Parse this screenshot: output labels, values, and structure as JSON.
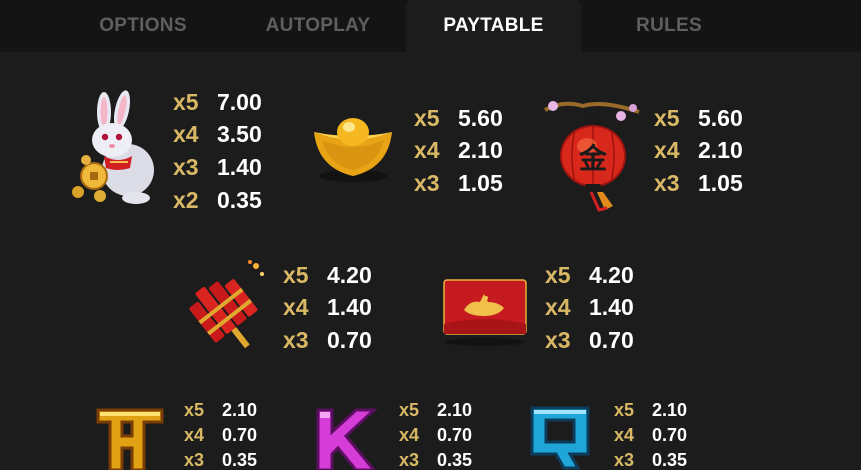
{
  "tabs": [
    {
      "label": "OPTIONS"
    },
    {
      "label": "AUTOPLAY"
    },
    {
      "label": "PAYTABLE"
    },
    {
      "label": "RULES"
    }
  ],
  "active_tab": "PAYTABLE",
  "colors": {
    "multiplier": "#d8b865",
    "value": "#ffffff",
    "background": "#1c1c1c",
    "tab_inactive": "#5f5f5f"
  },
  "symbols": [
    {
      "icon": "rabbit-icon",
      "pays": [
        {
          "m": "x5",
          "v": "7.00"
        },
        {
          "m": "x4",
          "v": "3.50"
        },
        {
          "m": "x3",
          "v": "1.40"
        },
        {
          "m": "x2",
          "v": "0.35"
        }
      ]
    },
    {
      "icon": "gold-ingot-icon",
      "pays": [
        {
          "m": "x5",
          "v": "5.60"
        },
        {
          "m": "x4",
          "v": "2.10"
        },
        {
          "m": "x3",
          "v": "1.05"
        }
      ]
    },
    {
      "icon": "lantern-icon",
      "pays": [
        {
          "m": "x5",
          "v": "5.60"
        },
        {
          "m": "x4",
          "v": "2.10"
        },
        {
          "m": "x3",
          "v": "1.05"
        }
      ]
    },
    {
      "icon": "firecracker-icon",
      "pays": [
        {
          "m": "x5",
          "v": "4.20"
        },
        {
          "m": "x4",
          "v": "1.40"
        },
        {
          "m": "x3",
          "v": "0.70"
        }
      ]
    },
    {
      "icon": "red-envelope-icon",
      "pays": [
        {
          "m": "x5",
          "v": "4.20"
        },
        {
          "m": "x4",
          "v": "1.40"
        },
        {
          "m": "x3",
          "v": "0.70"
        }
      ]
    },
    {
      "icon": "letter-a-icon",
      "pays": [
        {
          "m": "x5",
          "v": "2.10"
        },
        {
          "m": "x4",
          "v": "0.70"
        },
        {
          "m": "x3",
          "v": "0.35"
        }
      ]
    },
    {
      "icon": "letter-k-icon",
      "pays": [
        {
          "m": "x5",
          "v": "2.10"
        },
        {
          "m": "x4",
          "v": "0.70"
        },
        {
          "m": "x3",
          "v": "0.35"
        }
      ]
    },
    {
      "icon": "letter-q-icon",
      "pays": [
        {
          "m": "x5",
          "v": "2.10"
        },
        {
          "m": "x4",
          "v": "0.70"
        },
        {
          "m": "x3",
          "v": "0.35"
        }
      ]
    }
  ]
}
